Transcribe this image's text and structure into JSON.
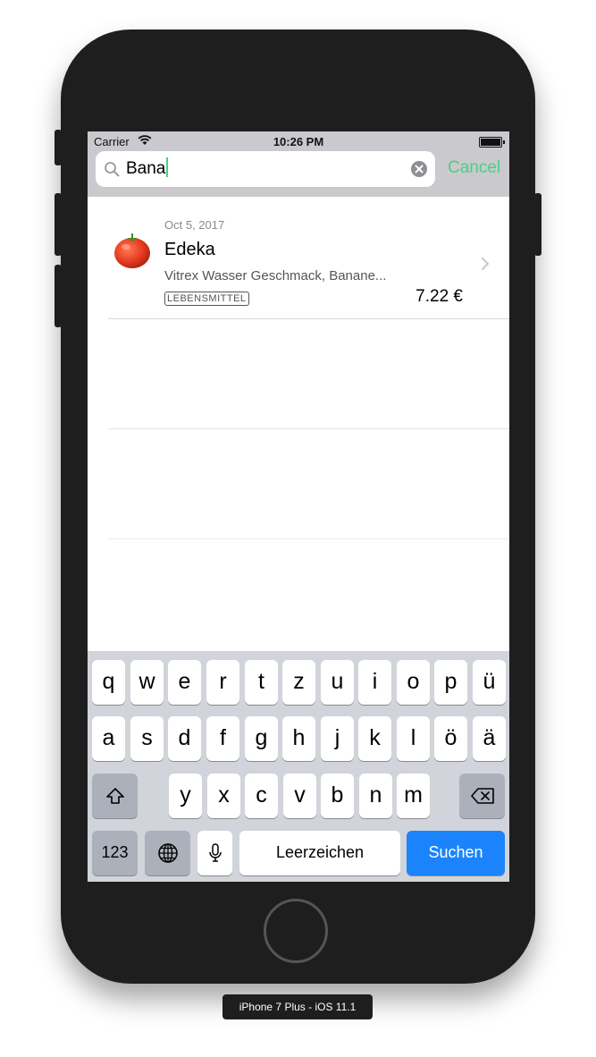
{
  "status": {
    "carrier": "Carrier",
    "time": "10:26 PM"
  },
  "search": {
    "query": "Bana",
    "cancel_label": "Cancel"
  },
  "results": [
    {
      "date": "Oct 5, 2017",
      "store": "Edeka",
      "items": "Vitrex Wasser Geschmack, Banane...",
      "category": "LEBENSMITTEL",
      "price": "7.22 €",
      "icon": "tomato-icon"
    }
  ],
  "keyboard": {
    "row1": [
      "q",
      "w",
      "e",
      "r",
      "t",
      "z",
      "u",
      "i",
      "o",
      "p",
      "ü"
    ],
    "row2": [
      "a",
      "s",
      "d",
      "f",
      "g",
      "h",
      "j",
      "k",
      "l",
      "ö",
      "ä"
    ],
    "row3": [
      "y",
      "x",
      "c",
      "v",
      "b",
      "n",
      "m"
    ],
    "numbers_label": "123",
    "space_label": "Leerzeichen",
    "search_label": "Suchen"
  },
  "device_label": "iPhone 7 Plus - iOS 11.1",
  "colors": {
    "accent": "#4cd080",
    "search_key": "#1b84fc"
  }
}
